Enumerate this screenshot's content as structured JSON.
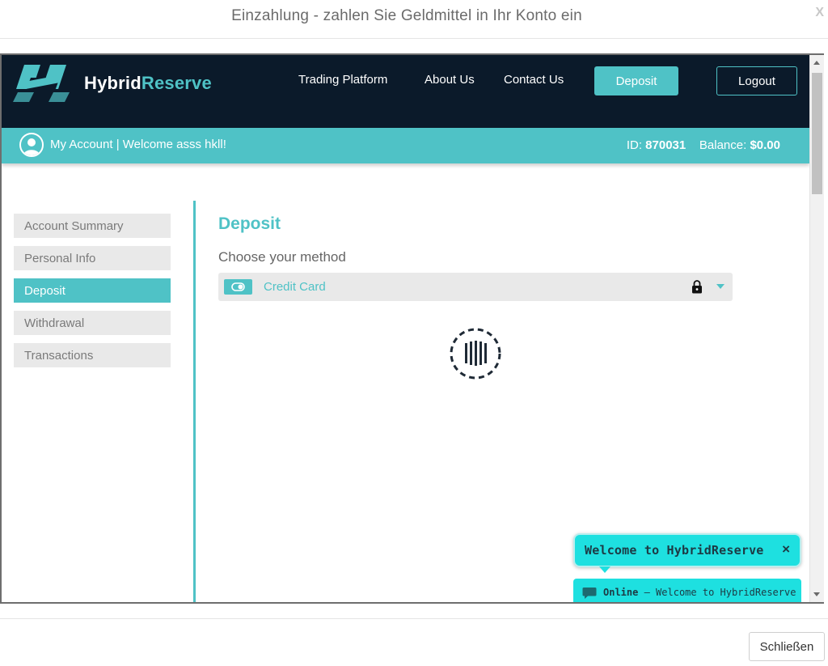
{
  "modal": {
    "title": "Einzahlung - zahlen Sie Geldmittel in Ihr Konto ein",
    "close_glyph": "X",
    "close_button_label": "Schließen"
  },
  "brand": {
    "name_part1": "H",
    "name_part2": "ybrid",
    "name_part3": "Reserve",
    "accent_color": "#4fc2c6",
    "nav_bg_color": "#0b1a2a"
  },
  "nav": {
    "links": [
      "Trading Platform",
      "About Us",
      "Contact Us"
    ],
    "deposit_label": "Deposit",
    "logout_label": "Logout"
  },
  "account": {
    "welcome": "My Account | Welcome asss hkll!",
    "id_label": "ID:",
    "id_value": "870031",
    "balance_label": "Balance:",
    "balance_value": "$0.00"
  },
  "sidebar": {
    "items": [
      {
        "label": "Account Summary",
        "active": false
      },
      {
        "label": "Personal Info",
        "active": false
      },
      {
        "label": "Deposit",
        "active": true
      },
      {
        "label": "Withdrawal",
        "active": false
      },
      {
        "label": "Transactions",
        "active": false
      }
    ]
  },
  "main": {
    "title": "Deposit",
    "subtitle": "Choose your method",
    "method": {
      "selected": "Credit Card",
      "icon": "card-toggle-icon"
    },
    "loading_icon": "spinner-icon"
  },
  "chat": {
    "bubble_title": "Welcome to HybridReserve",
    "close_glyph": "×",
    "status": "Online",
    "status_separator": " – ",
    "status_message": "Welcome to HybridReserve",
    "bg_color": "#1ee0e0"
  }
}
